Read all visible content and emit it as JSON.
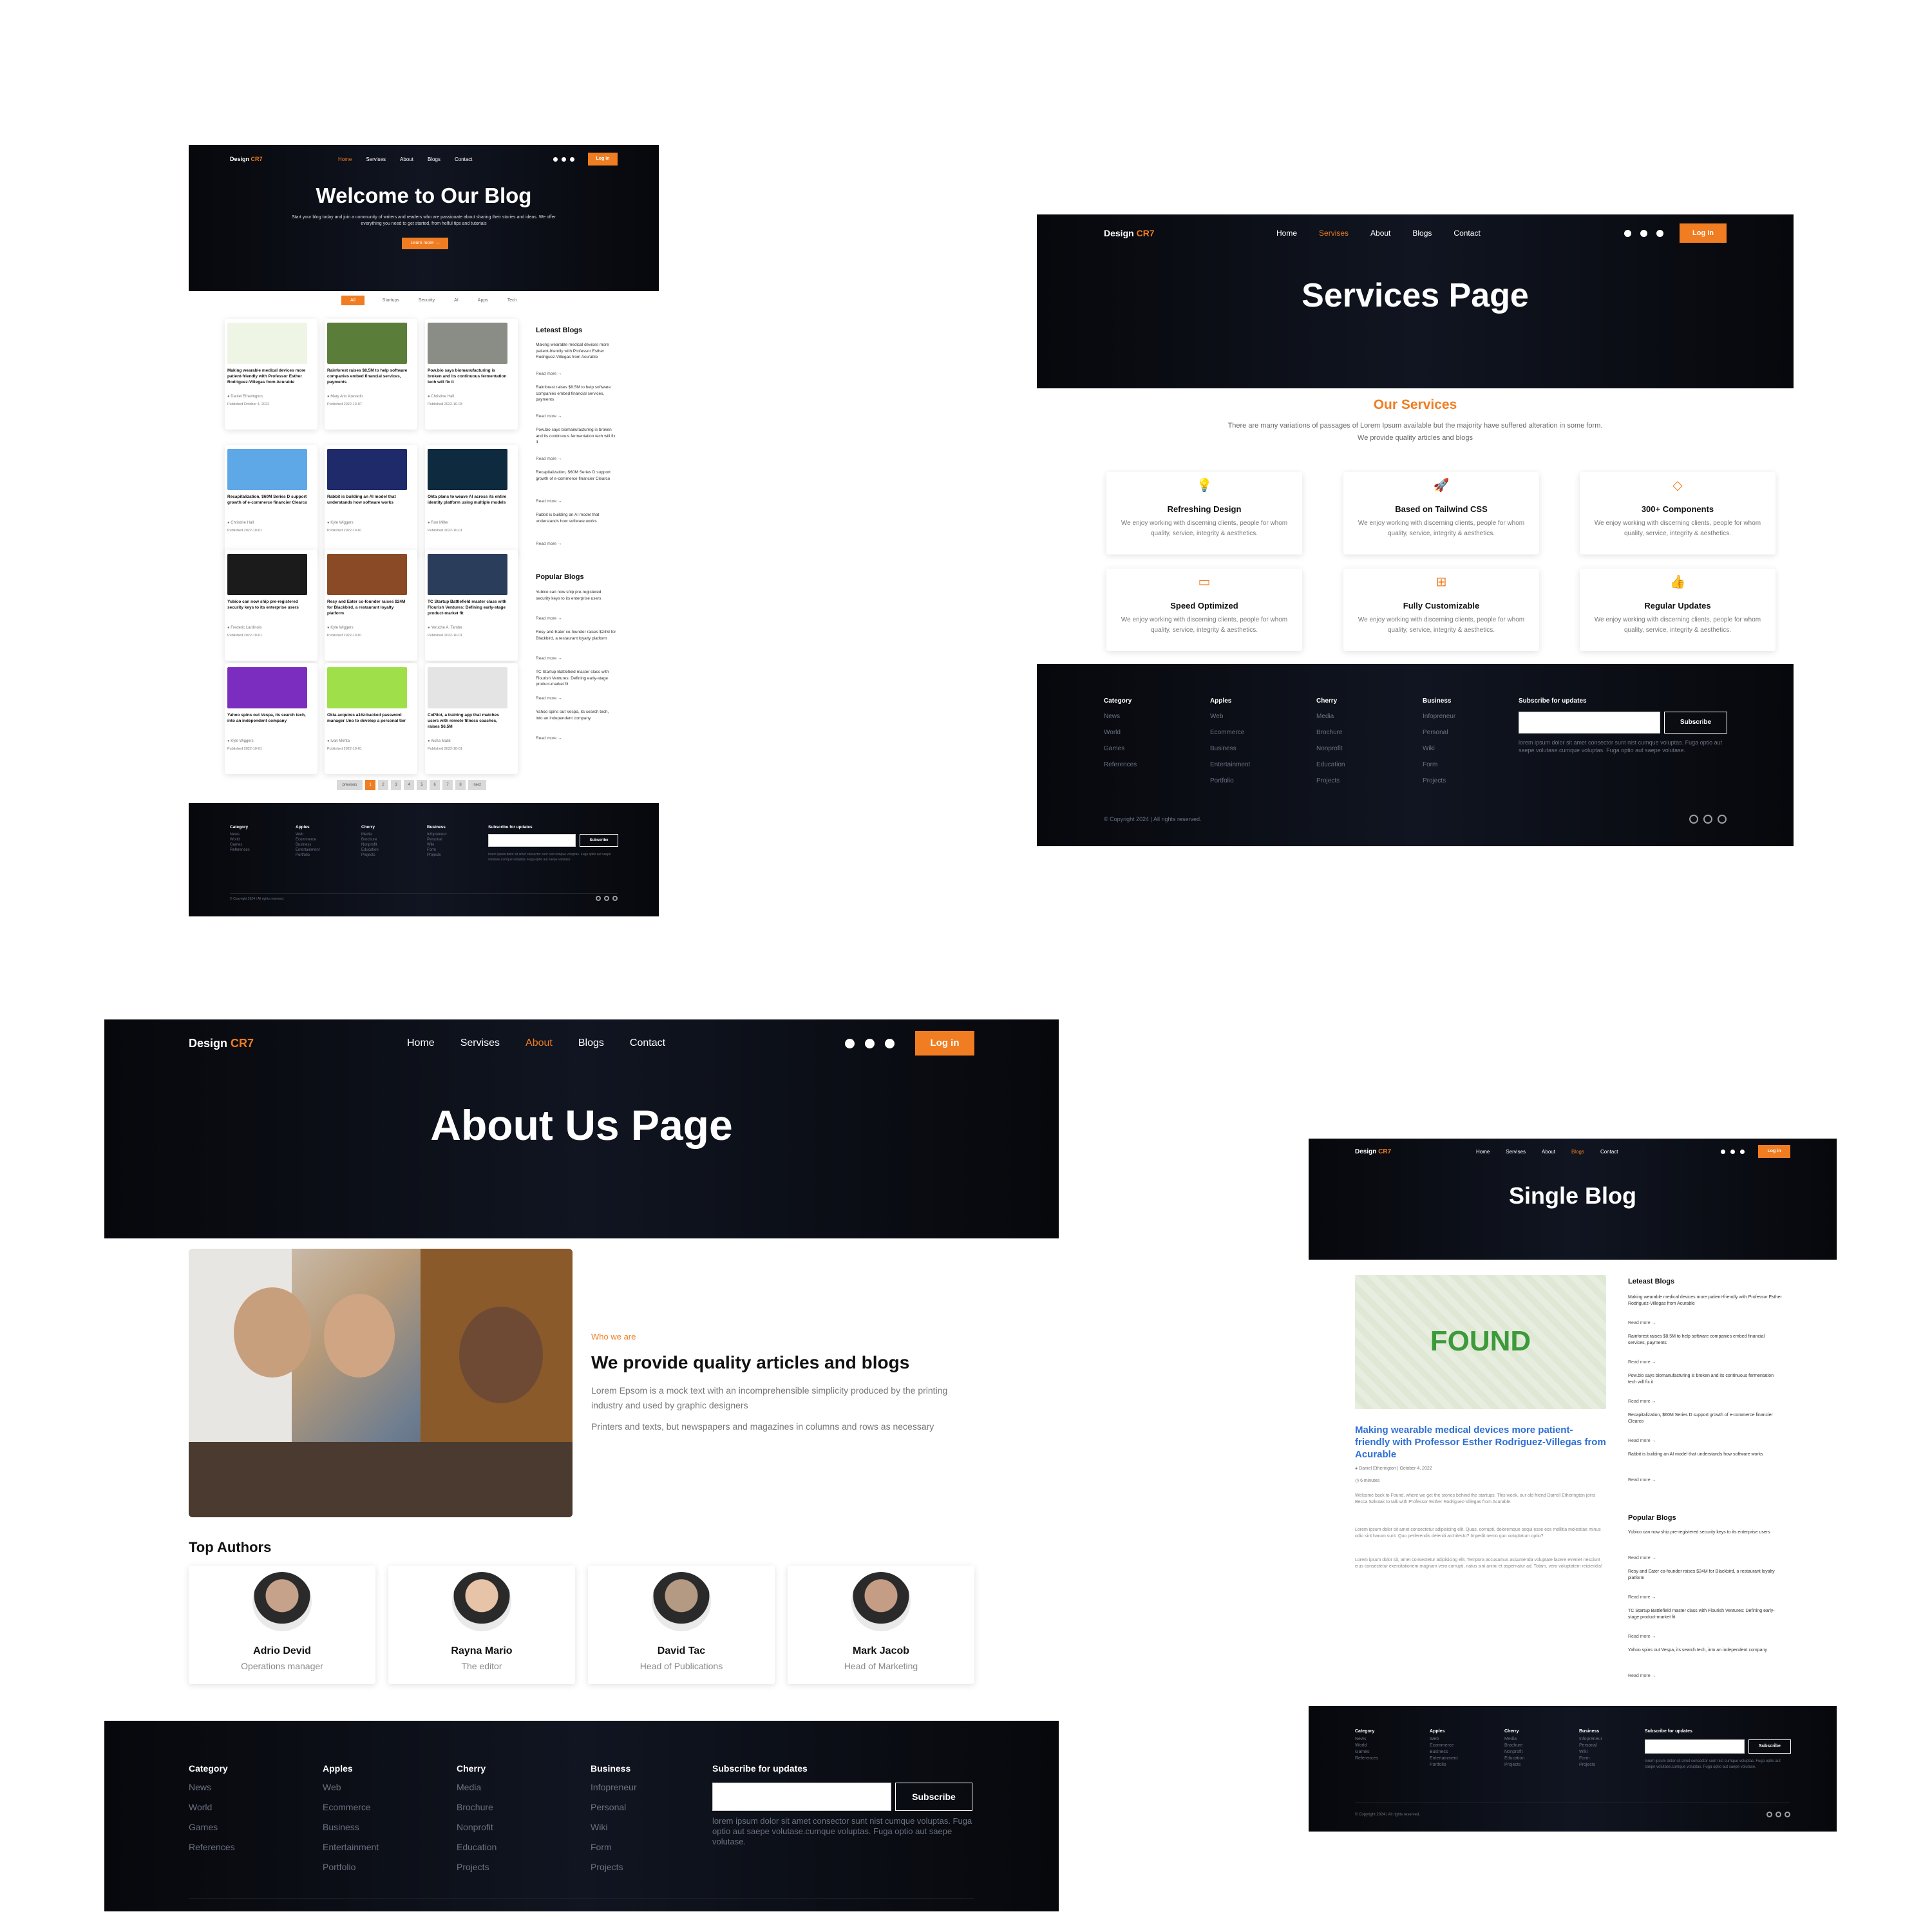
{
  "brand": {
    "name": "Design",
    "accent": "CR7",
    "accent_color": "#f07d22"
  },
  "nav": {
    "home": "Home",
    "services": "Servises",
    "about": "About",
    "blogs": "Blogs",
    "contact": "Contact",
    "login": "Log in"
  },
  "home": {
    "hero_title": "Welcome to Our Blog",
    "hero_text": "Start your blog today and join a community of writers and readers who are passionate about sharing their stories and ideas. We offer everything you need to get started, from helful tips and tutorials",
    "learn_more": "Learn more",
    "filters": [
      "All",
      "Startups",
      "Security",
      "AI",
      "Apps",
      "Tech"
    ],
    "posts": [
      {
        "title": "Making wearable medical devices more patient-friendly with Professor Esther Rodriguez-Villegas from Acurable",
        "author": "Daniel Etherington",
        "date": "Published October 4, 2022"
      },
      {
        "title": "Rainforest raises $8.5M to help software companies embed financial services, payments",
        "author": "Mary Ann Azevedo",
        "date": "Published 2022-10-07"
      },
      {
        "title": "Pow.bio says biomanufacturing is broken and its continuous fermentation tech will fix it",
        "author": "Christine Hall",
        "date": "Published 2022-10-03"
      },
      {
        "title": "Recapitalization, $60M Series D support growth of e-commerce financier Clearco",
        "author": "Christine Hall",
        "date": "Published 2022-10-01"
      },
      {
        "title": "Rabbit is building an AI model that understands how software works",
        "author": "Kyle Wiggers",
        "date": "Published 2022-10-01"
      },
      {
        "title": "Okta plans to weave AI across its entire identity platform using multiple models",
        "author": "Ron Miller",
        "date": "Published 2022-10-01"
      },
      {
        "title": "Yubico can now ship pre-registered security keys to its enterprise users",
        "author": "Frederic Lardinois",
        "date": "Published 2022-10-01"
      },
      {
        "title": "Resy and Eater co-founder raises $24M for Blackbird, a restaurant loyalty platform",
        "author": "Kyle Wiggers",
        "date": "Published 2022-10-01"
      },
      {
        "title": "TC Startup Battlefield master class with Flourish Ventures: Defining early-stage product-market fit",
        "author": "Yeruche A. Tambe",
        "date": "Published 2022-10-01"
      },
      {
        "title": "Yahoo spins out Vespa, its search tech, into an independent company",
        "author": "Kyle Wiggers",
        "date": "Published 2022-10-01"
      },
      {
        "title": "Okta acquires a16z-backed password manager Uno to develop a personal tier",
        "author": "Ivan Mehta",
        "date": "Published 2022-10-01"
      },
      {
        "title": "CoPilot, a training app that matches users with remote fitness coaches, raises $6.5M",
        "author": "Aisha Malik",
        "date": "Published 2022-10-01"
      }
    ],
    "latest_title": "Leteast Blogs",
    "latest": [
      "Making wearable medical devices more patient-friendly with Professor Esther Rodriguez-Villegas from Acurable",
      "Rainforest raises $8.5M to help software companies embed financial services, payments",
      "Pow.bio says biomanufacturing is broken and its continuous fermentation tech will fix it",
      "Recapitalization, $60M Series D support growth of e-commerce financier Clearco",
      "Rabbit is building an AI model that understands how software works"
    ],
    "popular_title": "Popular Blogs",
    "popular": [
      "Yubico can now ship pre-registered security keys to its enterprise users",
      "Resy and Eater co-founder raises $24M for Blackbird, a restaurant loyalty platform",
      "TC Startup Battlefield master class with Flourish Ventures: Defining early-stage product-market fit",
      "Yahoo spins out Vespa, its search tech, into an independent company"
    ],
    "read_more": "Read more",
    "pagination": {
      "prev": "previous",
      "pages": [
        "1",
        "2",
        "3",
        "4",
        "5",
        "6",
        "7",
        "8"
      ],
      "next": "next"
    }
  },
  "services": {
    "hero_title": "Services Page",
    "heading": "Our Services",
    "intro_1": "There are many variations of passages of Lorem Ipsum available but the majority have suffered alteration in some form.",
    "intro_2": "We provide quality articles and blogs",
    "items": [
      {
        "icon": "lightbulb-icon",
        "title": "Refreshing Design",
        "text": "We enjoy working with discerning clients, people for whom quality, service, integrity & aesthetics."
      },
      {
        "icon": "rocket-icon",
        "title": "Based on Tailwind CSS",
        "text": "We enjoy working with discerning clients, people for whom quality, service, integrity & aesthetics."
      },
      {
        "icon": "diamond-icon",
        "title": "300+ Components",
        "text": "We enjoy working with discerning clients, people for whom quality, service, integrity & aesthetics."
      },
      {
        "icon": "monitor-icon",
        "title": "Speed Optimized",
        "text": "We enjoy working with discerning clients, people for whom quality, service, integrity & aesthetics."
      },
      {
        "icon": "grid-icon",
        "title": "Fully Customizable",
        "text": "We enjoy working with discerning clients, people for whom quality, service, integrity & aesthetics."
      },
      {
        "icon": "thumbs-up-icon",
        "title": "Regular Updates",
        "text": "We enjoy working with discerning clients, people for whom quality, service, integrity & aesthetics."
      }
    ]
  },
  "about": {
    "hero_title": "About Us Page",
    "who": "Who we are",
    "heading": "We provide quality articles and blogs",
    "para_1": "Lorem Epsom is a mock text with an incomprehensible simplicity produced by the printing industry and used by graphic designers",
    "para_2": "Printers and texts, but newspapers and magazines in columns and rows as necessary",
    "authors_title": "Top Authors",
    "authors": [
      {
        "name": "Adrio Devid",
        "role": "Operations manager"
      },
      {
        "name": "Rayna Mario",
        "role": "The editor"
      },
      {
        "name": "David Tac",
        "role": "Head of Publications"
      },
      {
        "name": "Mark Jacob",
        "role": "Head of Marketing"
      }
    ]
  },
  "single": {
    "hero_title": "Single Blog",
    "image_text": "FOUND",
    "title": "Making wearable medical devices more patient-friendly with Professor Esther Rodriguez-Villegas from Acurable",
    "byline": "Daniel Etherington | October 4, 2022",
    "read_time": "6 minutes",
    "para_1": "Welcome back to Found, where we get the stories behind the startups. This week, our old friend Darrell Etherington joins Becca Szkutak to talk with Professor Esther Rodriguez-Villegas from Acurable.",
    "para_2": "Lorem ipsum dolor sit amet consectetur adipisicing elit. Quas, corrupti, doloremque sequi esse eos mollitia molestiae minus odio sint harum sunt. Quo perferendis deleniti architecto? Impedit nemo quo voluptatum optio?",
    "para_3": "Lorem ipsum dolor sit, amet consectetur adipisicing elit. Tempora accusamus assumenda voluptate facere eveniet nesciunt eius consectetur exercitationem magnam vero corrupti, natus sint animi et aspernatur ad. Totam, vero voluptatem reiciendis!",
    "latest_title": "Leteast Blogs",
    "latest": [
      "Making wearable medical devices more patient-friendly with Professor Esther Rodriguez-Villegas from Acurable",
      "Rainforest raises $8.5M to help software companies embed financial services, payments",
      "Pow.bio says biomanufacturing is broken and its continuous fermentation tech will fix it",
      "Recapitalization, $60M Series D support growth of e-commerce financier Clearco",
      "Rabbit is building an AI model that understands how software works"
    ],
    "popular_title": "Popular Blogs",
    "popular": [
      "Yubico can now ship pre-registered security keys to its enterprise users",
      "Resy and Eater co-founder raises $24M for Blackbird, a restaurant loyalty platform",
      "TC Startup Battlefield master class with Flourish Ventures: Defining early-stage product-market fit",
      "Yahoo spins out Vespa, its search tech, into an independent company"
    ]
  },
  "footer": {
    "columns": [
      {
        "title": "Category",
        "items": [
          "News",
          "World",
          "Games",
          "References"
        ]
      },
      {
        "title": "Apples",
        "items": [
          "Web",
          "Ecommerce",
          "Business",
          "Entertainment",
          "Portfolio"
        ]
      },
      {
        "title": "Cherry",
        "items": [
          "Media",
          "Brochure",
          "Nonprofit",
          "Education",
          "Projects"
        ]
      },
      {
        "title": "Business",
        "items": [
          "Infopreneur",
          "Personal",
          "Wiki",
          "Form",
          "Projects"
        ]
      }
    ],
    "subscribe_title": "Subscribe for updates",
    "subscribe_btn": "Subscribe",
    "subscribe_text": "lorem ipsum dolor sit amet consector sunt nist cumque voluptas. Fuga optio aut saepe volutase.cumque voluptas. Fuga optio aut saepe volutase.",
    "copyright": "© Copyright 2024 | All rights reserved."
  }
}
